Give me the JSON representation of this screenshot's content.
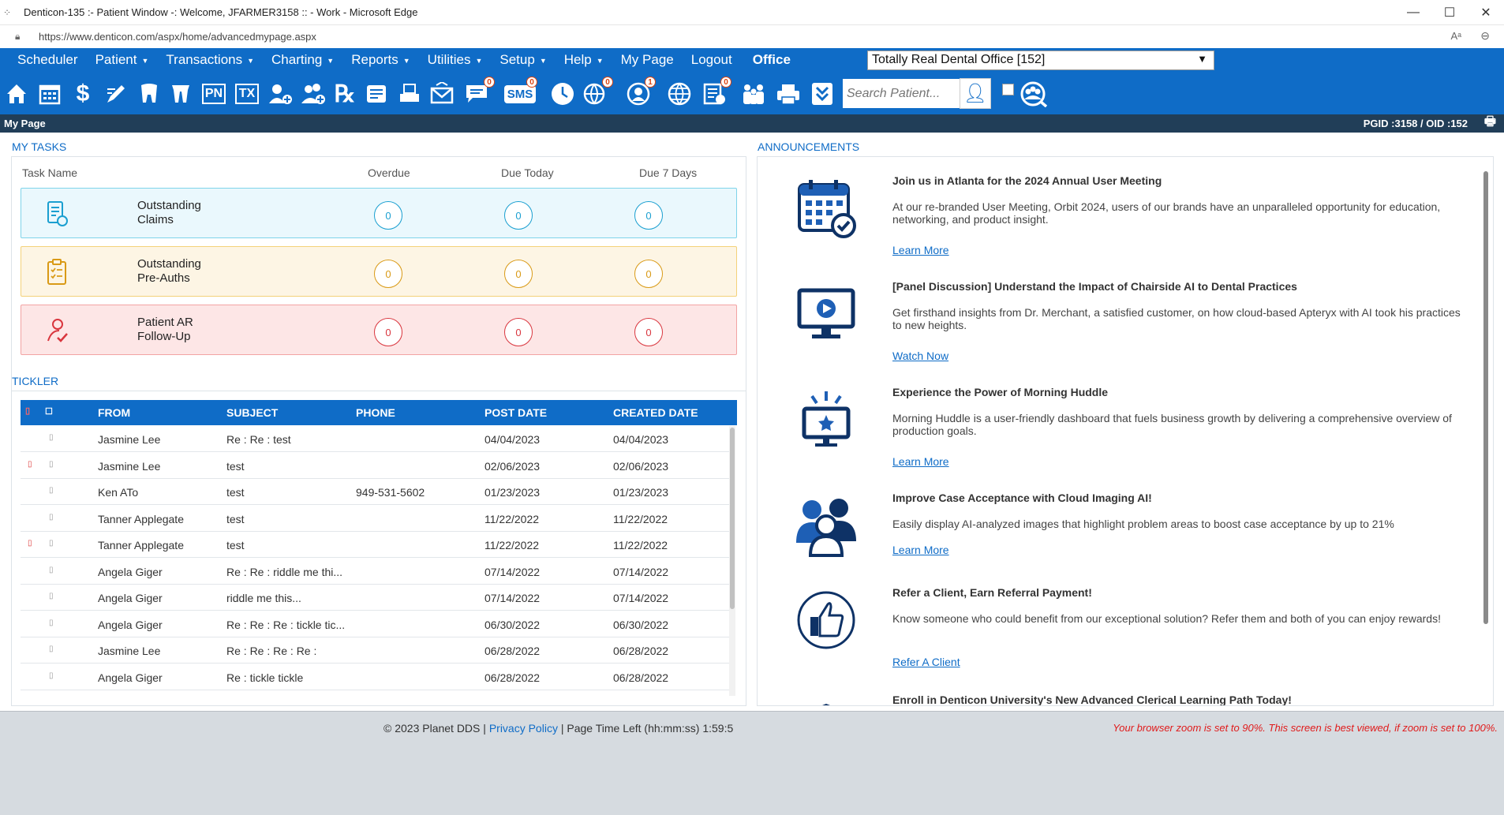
{
  "window": {
    "title": "Denticon-135 :- Patient Window -: Welcome, JFARMER3158 :: - Work - Microsoft Edge",
    "url": "https://www.denticon.com/aspx/home/advancedmypage.aspx"
  },
  "menu": {
    "items": [
      "Scheduler",
      "Patient",
      "Transactions",
      "Charting",
      "Reports",
      "Utilities",
      "Setup",
      "Help",
      "My Page",
      "Logout"
    ],
    "office_label": "Office",
    "office_value": "Totally Real Dental Office [152]"
  },
  "toolbar": {
    "icons": [
      "home-icon",
      "calendar-icon",
      "dollar-icon",
      "edit-icon",
      "tooth-icon",
      "teeth-icon",
      "pn-icon",
      "tx-icon",
      "add-patient-icon",
      "add-family-icon",
      "rx-icon",
      "document-icon",
      "scanner-icon",
      "mail-icon",
      "messages-icon",
      "sms-icon",
      "clock-icon",
      "globe-network-icon",
      "reminder-icon",
      "web-icon",
      "tasks-icon",
      "family-icon",
      "printer-icon",
      "collapse-icon"
    ],
    "pn_text": "PN",
    "tx_text": "TX",
    "rx_text": "℞",
    "sms_text": "SMS",
    "badges": {
      "messages": "0",
      "sms": "0",
      "globe": "0",
      "reminder": "1",
      "tasks": "0"
    },
    "search_placeholder": "Search Patient..."
  },
  "page": {
    "title": "My Page",
    "ids": "PGID :3158  /  OID :152"
  },
  "tasks": {
    "label": "MY TASKS",
    "headers": [
      "Task Name",
      "Overdue",
      "Due Today",
      "Due 7 Days"
    ],
    "rows": [
      {
        "name_line1": "Outstanding",
        "name_line2": "Claims",
        "overdue": "0",
        "today": "0",
        "week": "0"
      },
      {
        "name_line1": "Outstanding",
        "name_line2": "Pre-Auths",
        "overdue": "0",
        "today": "0",
        "week": "0"
      },
      {
        "name_line1": "Patient AR",
        "name_line2": "Follow-Up",
        "overdue": "0",
        "today": "0",
        "week": "0"
      }
    ]
  },
  "tickler": {
    "label": "TICKLER",
    "headers": [
      "FROM",
      "SUBJECT",
      "PHONE",
      "POST DATE",
      "CREATED DATE"
    ],
    "rows": [
      {
        "from": "Jasmine Lee",
        "subject": "Re : Re : test",
        "phone": "",
        "post": "04/04/2023",
        "created": "04/04/2023",
        "flag": false
      },
      {
        "from": "Jasmine Lee",
        "subject": "test",
        "phone": "",
        "post": "02/06/2023",
        "created": "02/06/2023",
        "flag": true
      },
      {
        "from": "Ken ATo",
        "subject": "test",
        "phone": "949-531-5602",
        "post": "01/23/2023",
        "created": "01/23/2023",
        "flag": false
      },
      {
        "from": "Tanner Applegate",
        "subject": "test",
        "phone": "",
        "post": "11/22/2022",
        "created": "11/22/2022",
        "flag": false
      },
      {
        "from": "Tanner Applegate",
        "subject": "test",
        "phone": "",
        "post": "11/22/2022",
        "created": "11/22/2022",
        "flag": true
      },
      {
        "from": "Angela Giger",
        "subject": "Re : Re : riddle me thi...",
        "phone": "",
        "post": "07/14/2022",
        "created": "07/14/2022",
        "flag": false
      },
      {
        "from": "Angela Giger",
        "subject": "riddle me this...",
        "phone": "",
        "post": "07/14/2022",
        "created": "07/14/2022",
        "flag": false
      },
      {
        "from": "Angela Giger",
        "subject": "Re : Re : Re : tickle tic...",
        "phone": "",
        "post": "06/30/2022",
        "created": "06/30/2022",
        "flag": false
      },
      {
        "from": "Jasmine Lee",
        "subject": "Re : Re : Re : Re :",
        "phone": "",
        "post": "06/28/2022",
        "created": "06/28/2022",
        "flag": false
      },
      {
        "from": "Angela Giger",
        "subject": "Re : tickle tickle",
        "phone": "",
        "post": "06/28/2022",
        "created": "06/28/2022",
        "flag": false
      }
    ]
  },
  "announcements": {
    "label": "ANNOUNCEMENTS",
    "items": [
      {
        "icon": "calendar-check-icon",
        "title": "Join us in Atlanta for the 2024 Annual User Meeting",
        "desc": "At our re-branded User Meeting, Orbit 2024, users of our brands have an unparalleled opportunity for education, networking, and product insight.",
        "link": "Learn More"
      },
      {
        "icon": "monitor-play-icon",
        "title": "[Panel Discussion] Understand the Impact of Chairside AI to Dental Practices",
        "desc": "Get firsthand insights from Dr. Merchant, a satisfied customer, on how cloud-based Apteryx with AI took his practices to new heights.",
        "link": "Watch Now"
      },
      {
        "icon": "monitor-star-icon",
        "title": "Experience the Power of Morning Huddle",
        "desc": "Morning Huddle is a user-friendly dashboard that fuels business growth by delivering a comprehensive overview of production goals.",
        "link": "Learn More"
      },
      {
        "icon": "people-icon",
        "title": "Improve Case Acceptance with Cloud Imaging AI!",
        "desc": "Easily display AI-analyzed images that highlight problem areas to boost case acceptance by up to 21%",
        "link": "Learn More"
      },
      {
        "icon": "thumbs-up-icon",
        "title": "Refer a Client, Earn Referral Payment!",
        "desc": "Know someone who could benefit from our exceptional solution? Refer them and both of you can enjoy rewards!",
        "link": "Refer A Client"
      },
      {
        "icon": "graduation-icon",
        "title": "Enroll in Denticon University's New Advanced Clerical Learning Path Today!",
        "desc": "",
        "link": ""
      }
    ]
  },
  "footer": {
    "copyright": "© 2023 Planet DDS",
    "sep": "|",
    "privacy": "Privacy Policy",
    "page_time": "Page Time Left (hh:mm:ss) 1:59:5",
    "zoom_warning": "Your browser zoom is set to 90%. This screen is best viewed, if zoom is set to 100%."
  }
}
